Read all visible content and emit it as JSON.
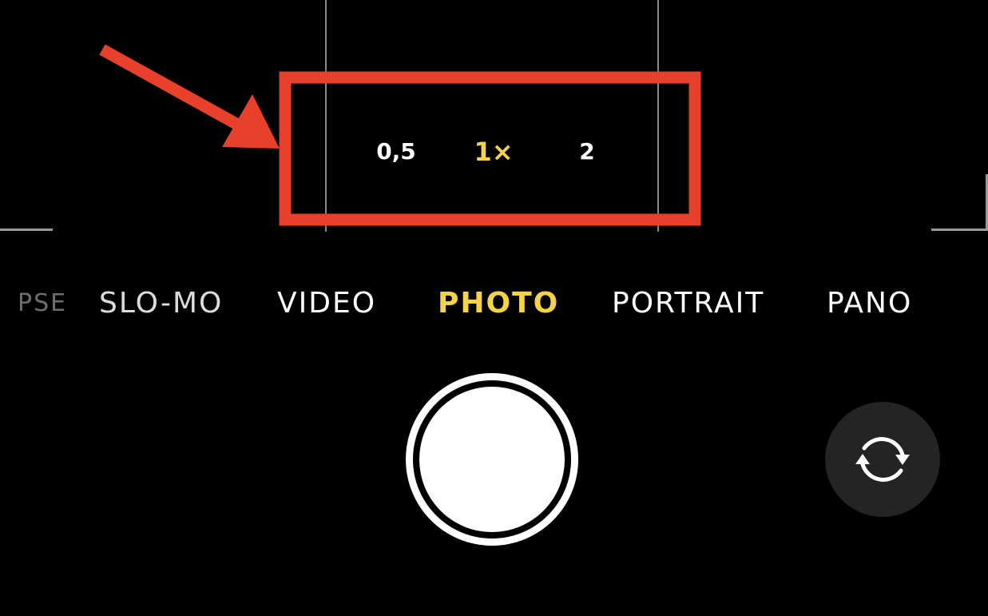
{
  "zoom": {
    "options": [
      {
        "label": "0,5"
      },
      {
        "label": "1×"
      },
      {
        "label": "2"
      }
    ],
    "selected_index": 1
  },
  "modes": {
    "items": [
      {
        "label": "PSE"
      },
      {
        "label": "SLO-MO"
      },
      {
        "label": "VIDEO"
      },
      {
        "label": "PHOTO"
      },
      {
        "label": "PORTRAIT"
      },
      {
        "label": "PANO"
      }
    ],
    "selected_index": 3
  },
  "controls": {
    "shutter": "shutter-button",
    "flip_camera_icon": "camera-flip-icon"
  },
  "colors": {
    "background": "#000000",
    "accent_yellow": "#f5d348",
    "annotation_red": "#e8402a",
    "text_white": "#ffffff",
    "flip_button_bg": "#242424"
  },
  "annotation": {
    "icons": [
      "red-arrow",
      "red-highlight-box"
    ]
  }
}
